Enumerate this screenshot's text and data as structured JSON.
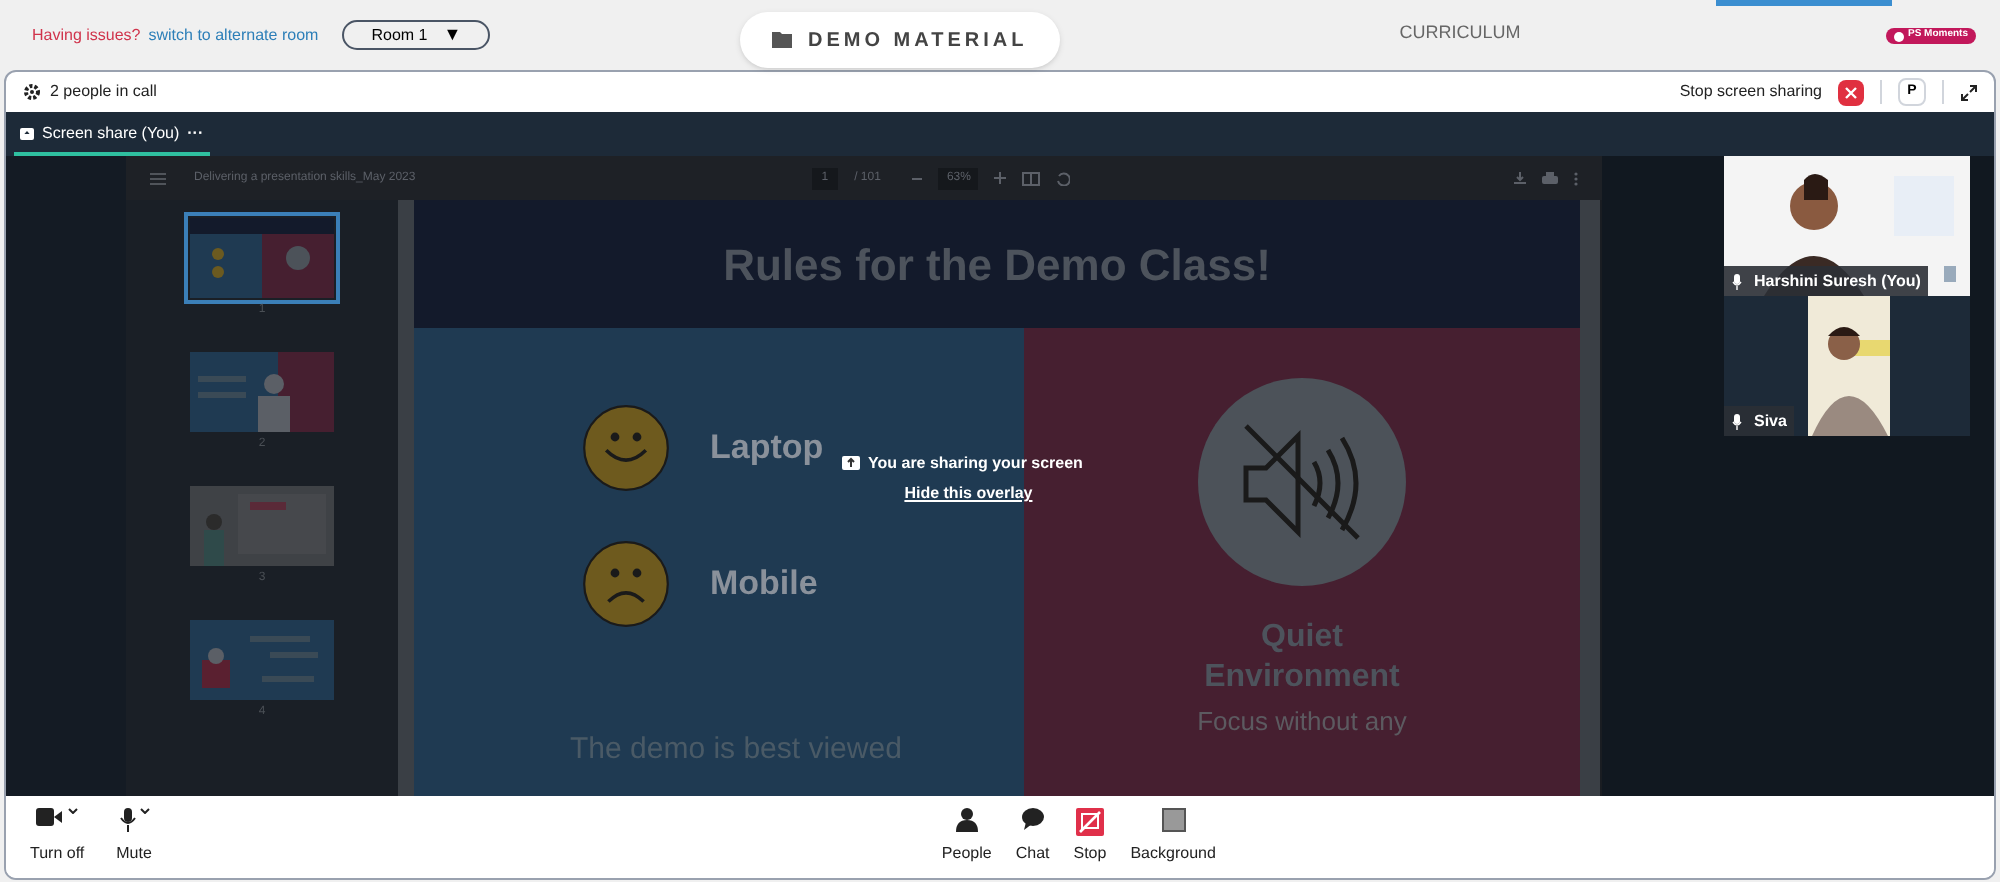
{
  "top_bar": {
    "issue_label": "Having issues?",
    "alternate_link": "switch to alternate room",
    "room_select": {
      "value": "Room 1",
      "caret": "▼"
    },
    "tabs": [
      {
        "label": "DEMO MATERIAL",
        "selected": true
      },
      {
        "label": "CURRICULUM",
        "selected": false
      }
    ],
    "badge": "PS Moments"
  },
  "call_header": {
    "people_count": "2 people in call",
    "stop_sharing_label": "Stop screen sharing",
    "profile_button": "P"
  },
  "share_tab": {
    "label": "Screen share (You)",
    "more": "···"
  },
  "pdf_viewer": {
    "title": "Delivering a presentation skills_May 2023",
    "page": "1",
    "page_total": "/ 101",
    "zoom": "63%",
    "thumbnails": [
      {
        "number": "1",
        "selected": true
      },
      {
        "number": "2",
        "selected": false
      },
      {
        "number": "3",
        "selected": false
      },
      {
        "number": "4",
        "selected": false
      }
    ]
  },
  "slide": {
    "title": "Rules for the Demo Class!",
    "left_items": [
      "Laptop",
      "Mobile"
    ],
    "left_caption": "The demo is best viewed",
    "right_title": "Quiet Environment",
    "right_caption": "Focus without any"
  },
  "overlay": {
    "message": "You are sharing your screen",
    "hide_link": "Hide this overlay"
  },
  "participants": [
    {
      "name": "Harshini Suresh (You)"
    },
    {
      "name": "Siva"
    }
  ],
  "toolbar": [
    {
      "kind": "camera",
      "label": "Turn off"
    },
    {
      "kind": "mic",
      "label": "Mute"
    },
    {
      "kind": "people",
      "label": "People"
    },
    {
      "kind": "chat",
      "label": "Chat"
    },
    {
      "kind": "stop",
      "label": "Stop"
    },
    {
      "kind": "background",
      "label": "Background"
    }
  ]
}
